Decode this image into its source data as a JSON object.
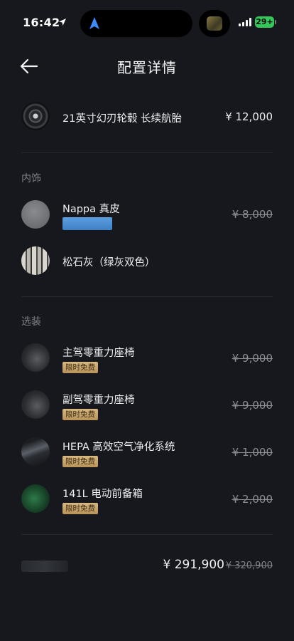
{
  "status_bar": {
    "time": "16:42",
    "battery": "29+",
    "battery_color": "#34c759"
  },
  "header": {
    "title": "配置详情",
    "back_icon": "back-arrow-icon"
  },
  "wheel_item": {
    "label": "21英寸幻刃轮毂 长续航胎",
    "price": "¥ 12,000"
  },
  "interior": {
    "section_label": "内饰",
    "items": [
      {
        "label": "Nappa 真皮",
        "price": "¥ 8,000",
        "struck": true
      },
      {
        "label": "松石灰（绿灰双色）",
        "price": ""
      }
    ]
  },
  "options": {
    "section_label": "选装",
    "badge_text": "限时免费",
    "items": [
      {
        "label": "主驾零重力座椅",
        "price": "¥ 9,000",
        "badge": "限时免费"
      },
      {
        "label": "副驾零重力座椅",
        "price": "¥ 9,000",
        "badge": "限时免费"
      },
      {
        "label": "HEPA 高效空气净化系统",
        "price": "¥ 1,000",
        "badge": "限时免费"
      },
      {
        "label": "141L 电动前备箱",
        "price": "¥ 2,000",
        "badge": "限时免费"
      }
    ]
  },
  "footer": {
    "total": "¥ 291,900",
    "original_total": "¥ 320,900"
  },
  "colors": {
    "background": "#16181d",
    "badge_gold": "#c9a66b",
    "swatch_blue": "#4a8ed4"
  }
}
